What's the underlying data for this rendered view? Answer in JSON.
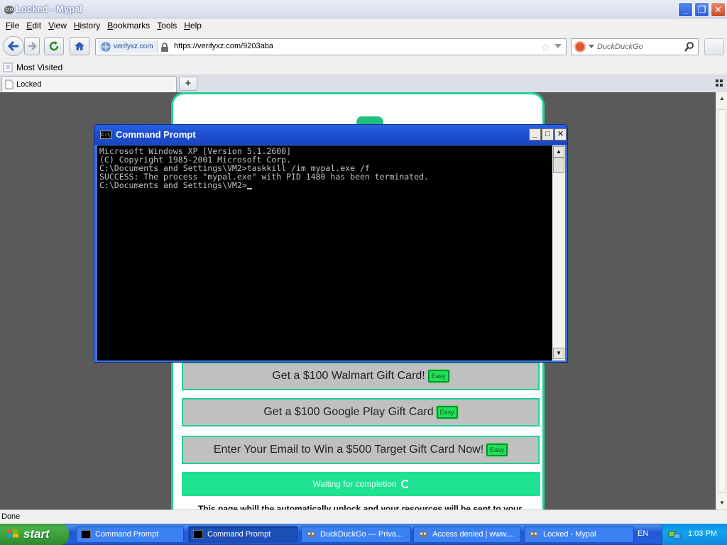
{
  "browser": {
    "title": "Locked - Mypal",
    "menu": [
      {
        "label": "File",
        "mn": "F",
        "rest": "ile"
      },
      {
        "label": "Edit",
        "mn": "E",
        "rest": "dit"
      },
      {
        "label": "View",
        "mn": "V",
        "rest": "iew"
      },
      {
        "label": "History",
        "mn": "H",
        "rest": "istory"
      },
      {
        "label": "Bookmarks",
        "mn": "B",
        "rest": "ookmarks"
      },
      {
        "label": "Tools",
        "mn": "T",
        "rest": "ools"
      },
      {
        "label": "Help",
        "mn": "H",
        "rest": "elp"
      }
    ],
    "site_identity": "verifyxz.com",
    "url": "https://verifyxz.com/9203aba",
    "search_placeholder": "DuckDuckGo",
    "bookmark_label": "Most Visited",
    "tab_label": "Locked",
    "new_tab_symbol": "+",
    "status": "Done"
  },
  "page": {
    "offers": [
      {
        "text": "Get a $100 Walmart Gift Card!",
        "badge": "Easy"
      },
      {
        "text": "Get a $100 Google Play Gift Card",
        "badge": "Easy"
      },
      {
        "text": "Enter Your Email to Win a $500 Target Gift Card Now!",
        "badge": "Easy"
      }
    ],
    "waiting_text": "Waiting for completion",
    "note": "This page whill the automatically unlock and your resources will be sent to your"
  },
  "cmd": {
    "title": "Command Prompt",
    "icon_text": "C:\\",
    "lines": [
      "Microsoft Windows XP [Version 5.1.2600]",
      "(C) Copyright 1985-2001 Microsoft Corp.",
      "",
      "C:\\Documents and Settings\\VM2>taskkill /im mypal.exe /f",
      "SUCCESS: The process \"mypal.exe\" with PID 1480 has been terminated.",
      "",
      "C:\\Documents and Settings\\VM2>"
    ]
  },
  "taskbar": {
    "start_label": "start",
    "tasks": [
      {
        "label": "Command Prompt"
      },
      {
        "label": "Command Prompt"
      },
      {
        "label": "DuckDuckGo — Priva..."
      },
      {
        "label": "Access denied | www...."
      },
      {
        "label": "Locked - Mypal"
      }
    ],
    "language": "EN",
    "clock": "1:03 PM"
  },
  "colors": {
    "accent_green": "#1ed393",
    "easy_badge": "#22e056",
    "xp_blue": "#245edb"
  },
  "icons": [
    "mypal-icon",
    "back-icon",
    "forward-icon",
    "reload-icon",
    "home-icon",
    "globe-icon",
    "lock-icon",
    "star-icon",
    "duckduckgo-icon",
    "search-icon",
    "cmd-icon",
    "windows-flag-icon",
    "spinner-icon"
  ]
}
